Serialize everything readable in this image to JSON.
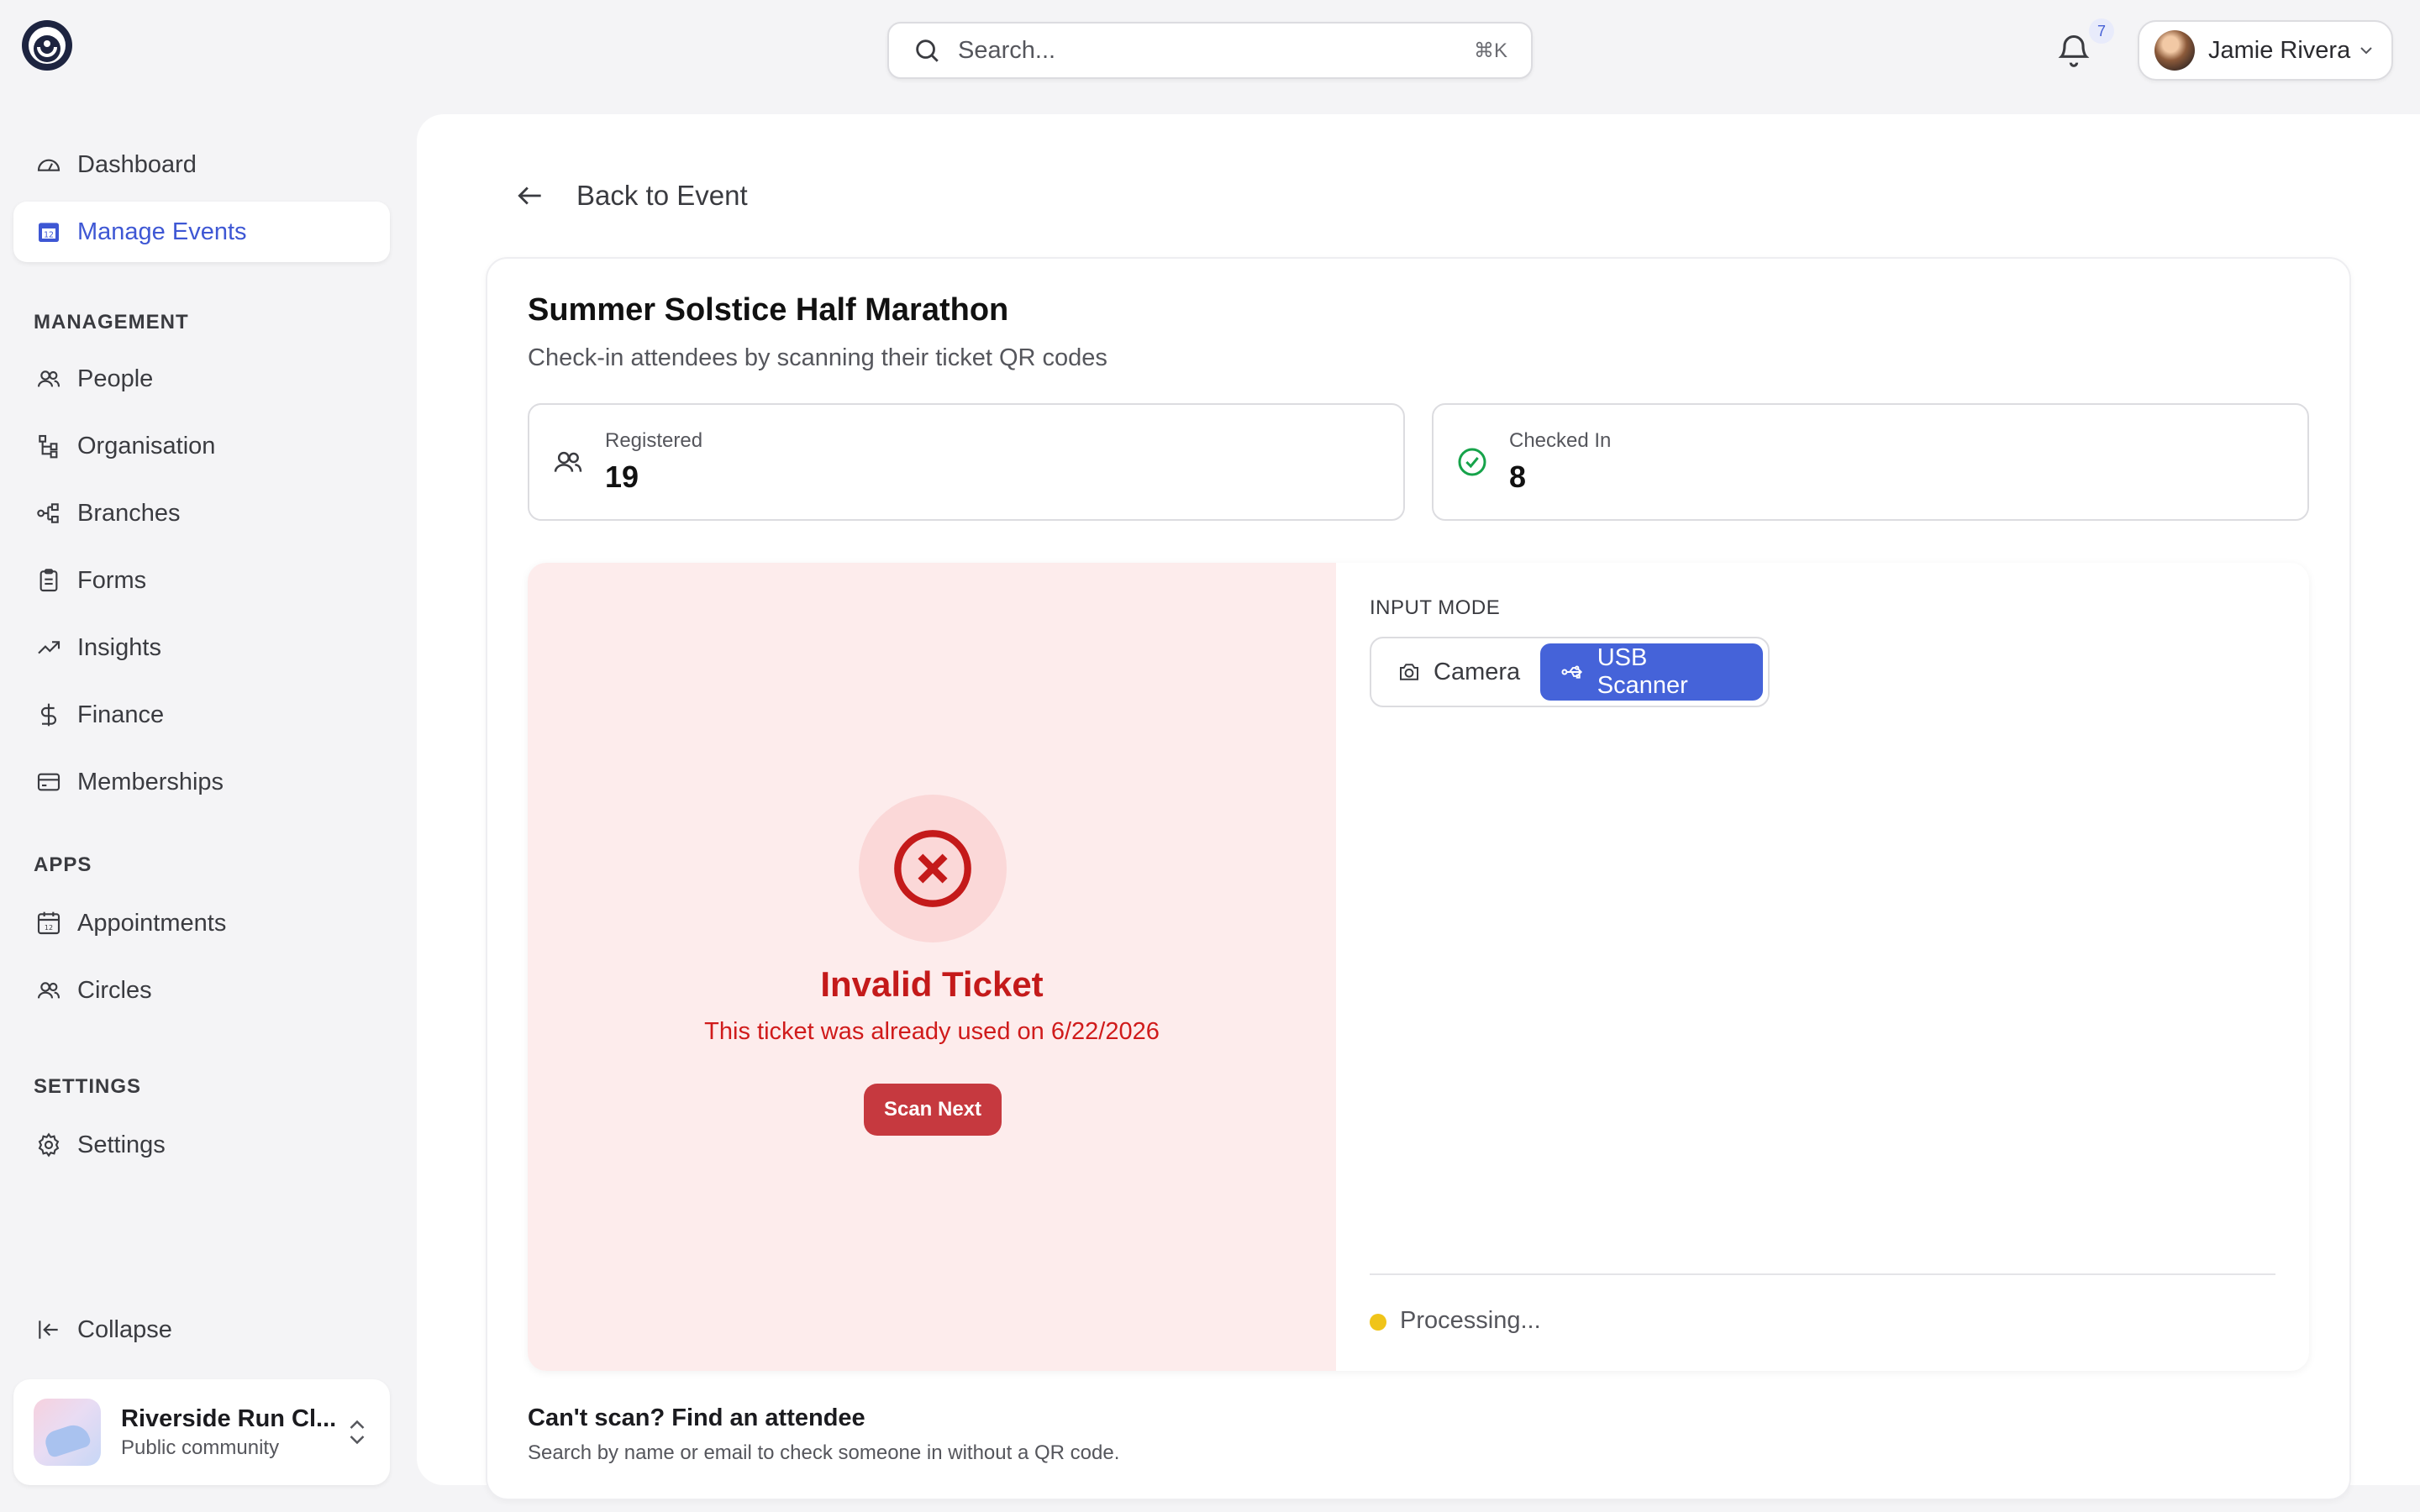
{
  "header": {
    "search_placeholder": "Search...",
    "search_shortcut": "⌘K",
    "notifications_count": "7",
    "user_name": "Jamie Rivera"
  },
  "sidebar": {
    "dashboard": "Dashboard",
    "manage_events": "Manage Events",
    "management_label": "MANAGEMENT",
    "management_items": [
      "People",
      "Organisation",
      "Branches",
      "Forms",
      "Insights",
      "Finance",
      "Memberships"
    ],
    "apps_label": "APPS",
    "apps_items": [
      "Appointments",
      "Circles"
    ],
    "settings_label": "SETTINGS",
    "settings_items": [
      "Settings"
    ],
    "collapse": "Collapse",
    "community_name": "Riverside Run Cl...",
    "community_type": "Public community"
  },
  "main": {
    "back_label": "Back to Event",
    "event_title": "Summer Solstice Half Marathon",
    "event_subtitle": "Check-in attendees by scanning their ticket QR codes",
    "stats": {
      "registered_label": "Registered",
      "registered_value": "19",
      "checked_in_label": "Checked In",
      "checked_in_value": "8"
    },
    "result": {
      "title": "Invalid Ticket",
      "message": "This ticket was already used on 6/22/2026",
      "button": "Scan Next"
    },
    "input_mode": {
      "label": "INPUT MODE",
      "camera": "Camera",
      "usb": "USB Scanner",
      "selected": "USB Scanner"
    },
    "status": "Processing...",
    "find": {
      "title": "Can't scan? Find an attendee",
      "subtitle": "Search by name or email to check someone in without a QR code."
    }
  },
  "colors": {
    "accent": "#4563d9",
    "error": "#c41a1a",
    "error_bg": "#fdecec",
    "success": "#16a34a",
    "warning": "#f0c419"
  }
}
